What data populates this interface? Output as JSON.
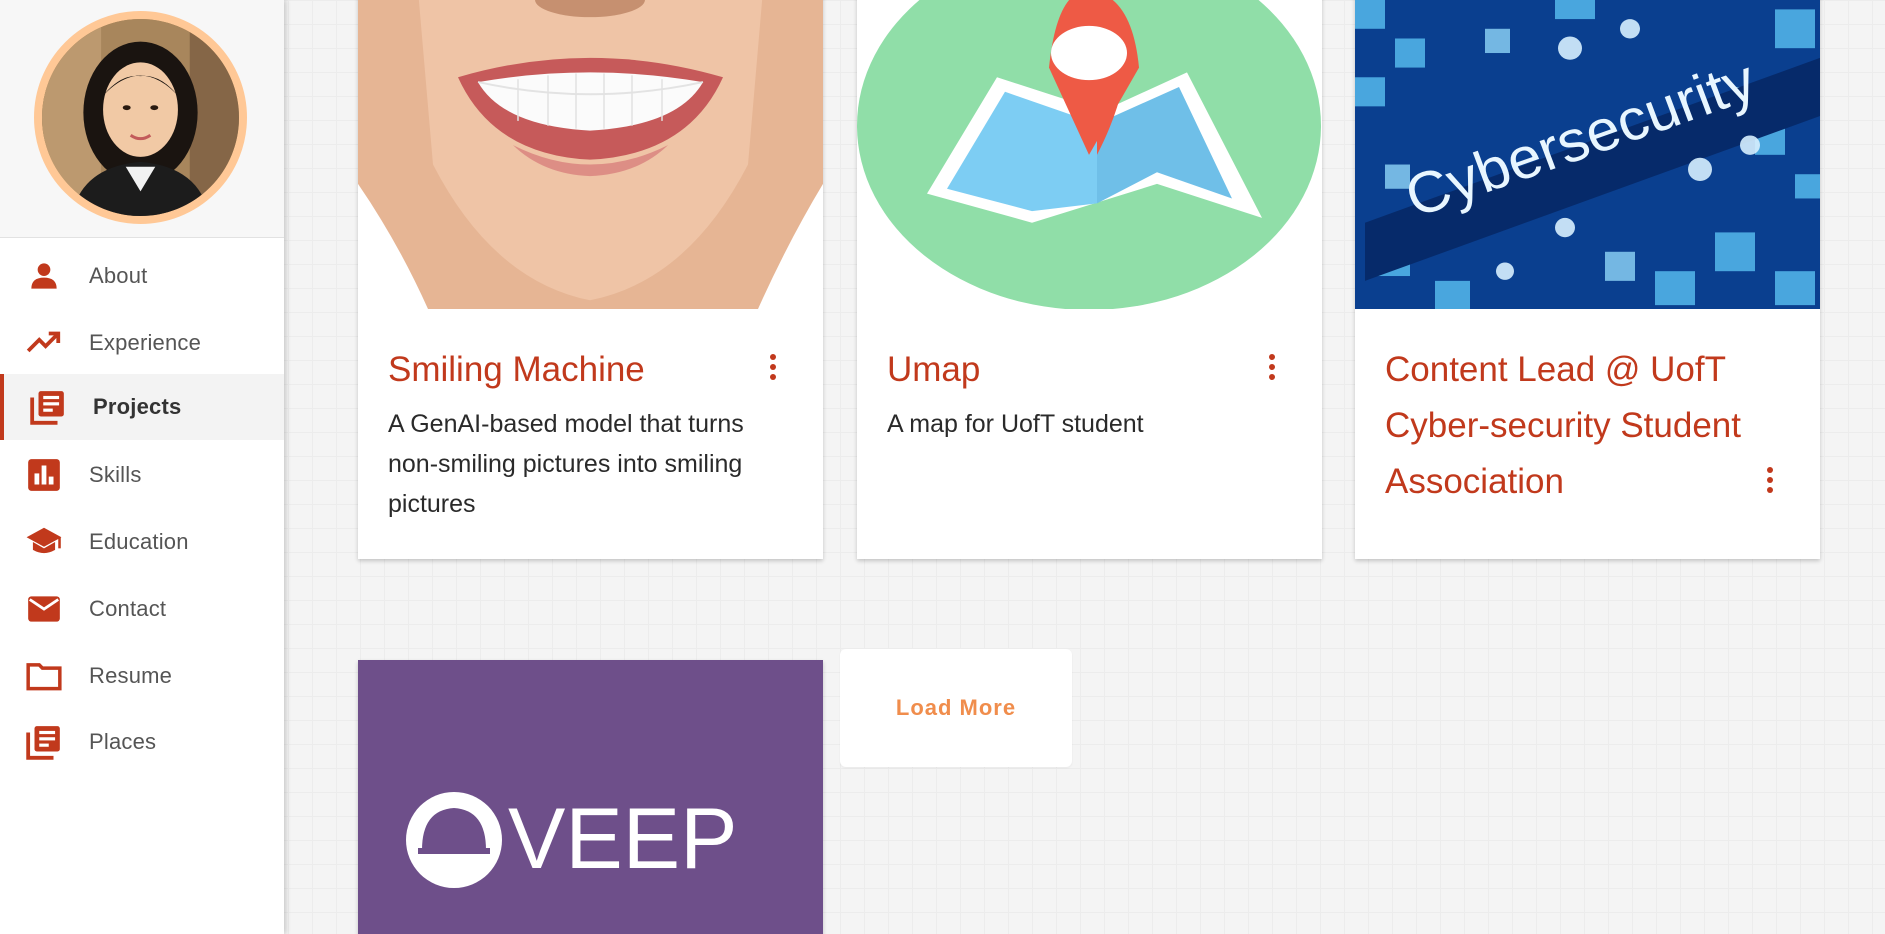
{
  "sidebar": {
    "items": [
      {
        "label": "About",
        "icon": "person-icon"
      },
      {
        "label": "Experience",
        "icon": "trending-up-icon"
      },
      {
        "label": "Projects",
        "icon": "library-books-icon",
        "active": true
      },
      {
        "label": "Skills",
        "icon": "bar-chart-icon"
      },
      {
        "label": "Education",
        "icon": "graduation-cap-icon"
      },
      {
        "label": "Contact",
        "icon": "mail-icon"
      },
      {
        "label": "Resume",
        "icon": "folder-icon"
      },
      {
        "label": "Places",
        "icon": "library-books-icon"
      }
    ]
  },
  "projects": [
    {
      "title": "Smiling Machine",
      "description": "A GenAI-based model that turns non-smiling pictures into smiling pictures",
      "image": "smile-photo"
    },
    {
      "title": "Umap",
      "description": "A map for UofT student",
      "image": "map-pin-illustration"
    },
    {
      "title": "Content Lead @ UofT Cyber-security Student Association",
      "description": "",
      "image": "cybersecurity-keyboard",
      "image_text": "Cybersecurity"
    },
    {
      "title": "",
      "description": "",
      "image": "veep-logo",
      "image_text": "VEEP"
    }
  ],
  "load_more_label": "Load More",
  "colors": {
    "accent": "#c1391c",
    "load_more": "#f08d4c",
    "avatar_border": "#ffc896",
    "veep_purple": "#6e4f8a"
  }
}
